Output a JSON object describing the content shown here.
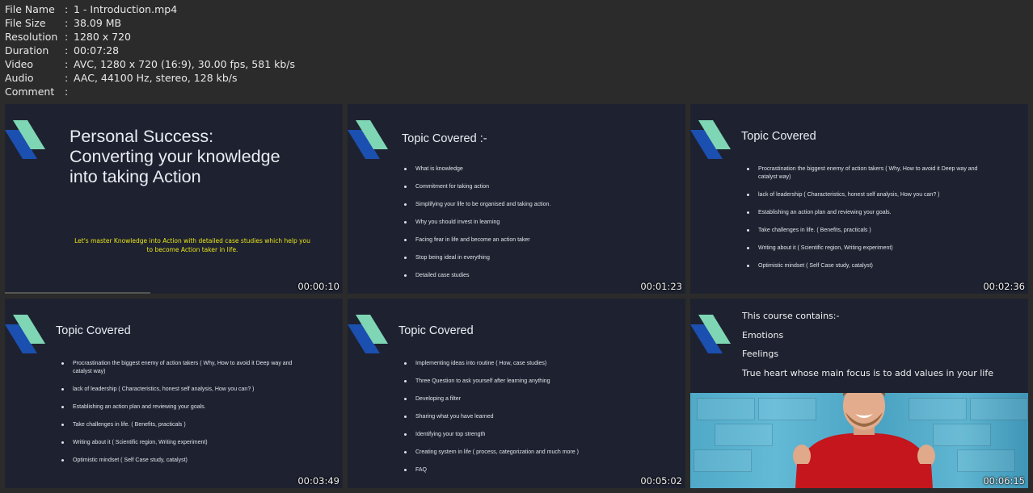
{
  "file_info": [
    {
      "label": "File Name",
      "value": "1 - Introduction.mp4"
    },
    {
      "label": "File Size",
      "value": "38.09 MB"
    },
    {
      "label": "Resolution",
      "value": "1280 x 720"
    },
    {
      "label": "Duration",
      "value": "00:07:28"
    },
    {
      "label": "Video",
      "value": "AVC, 1280 x 720 (16:9), 30.00 fps, 581 kb/s"
    },
    {
      "label": "Audio",
      "value": "AAC, 44100 Hz, stereo, 128 kb/s"
    },
    {
      "label": "Comment",
      "value": ""
    }
  ],
  "separator": ":",
  "thumbnails": [
    {
      "timestamp": "00:00:10",
      "title_lines": [
        "Personal Success:",
        "Converting your knowledge",
        "into taking Action"
      ],
      "tagline": "Let's master Knowledge into Action with detailed case studies which help you to become Action taker in life."
    },
    {
      "timestamp": "00:01:23",
      "title": "Topic Covered :-",
      "bullets": [
        "What is knowledge",
        "Commitment for taking action",
        "Simplifying your life to be organised and taking action.",
        "Why you should invest in learning",
        "Facing fear in life and become an action taker",
        "Stop being ideal in everything",
        "Detailed case studies"
      ]
    },
    {
      "timestamp": "00:02:36",
      "title": "Topic Covered",
      "bullets": [
        "Procrastination the biggest enemy of action takers ( Why, How to avoid it Deep way and catalyst way)",
        "lack of leadership ( Characteristics, honest self analysis, How you can? )",
        "Establishing an action plan and reviewing your goals.",
        "Take challenges in life. ( Benefits, practicals )",
        "Writing about it ( Scientific region, Writing experiment)",
        "Optimistic mindset ( Self Case study, catalyst)"
      ]
    },
    {
      "timestamp": "00:03:49",
      "title": "Topic Covered",
      "bullets": [
        "Procrastination the biggest enemy of action takers ( Why, How to avoid it Deep way and catalyst way)",
        "lack of leadership ( Characteristics, honest self analysis, How you can? )",
        "Establishing an action plan and reviewing your goals.",
        "Take challenges in life. ( Benefits, practicals )",
        "Writing about it ( Scientific region, Writing experiment)",
        "Optimistic mindset ( Self Case study, catalyst)"
      ]
    },
    {
      "timestamp": "00:05:02",
      "title": "Topic Covered",
      "bullets": [
        "Implementing ideas into routine ( How, case studies)",
        "Three Question to ask yourself after learning anything",
        "Developing a filter",
        "Sharing what you have learned",
        "Identifying your top strength",
        "Creating system in life ( process, categorization and much more )",
        "FAQ"
      ]
    },
    {
      "timestamp": "00:06:15",
      "lines": [
        "This course contains:-",
        "Emotions",
        "Feelings",
        "True heart whose main focus is to add values in your life"
      ]
    }
  ],
  "colors": {
    "background": "#2b2b2b",
    "slide_bg": "#1e2230",
    "logo_blue": "#1b4fb0",
    "logo_green": "#7fd6b4",
    "tagline": "#e8e31a",
    "shirt_red": "#c4161c"
  }
}
